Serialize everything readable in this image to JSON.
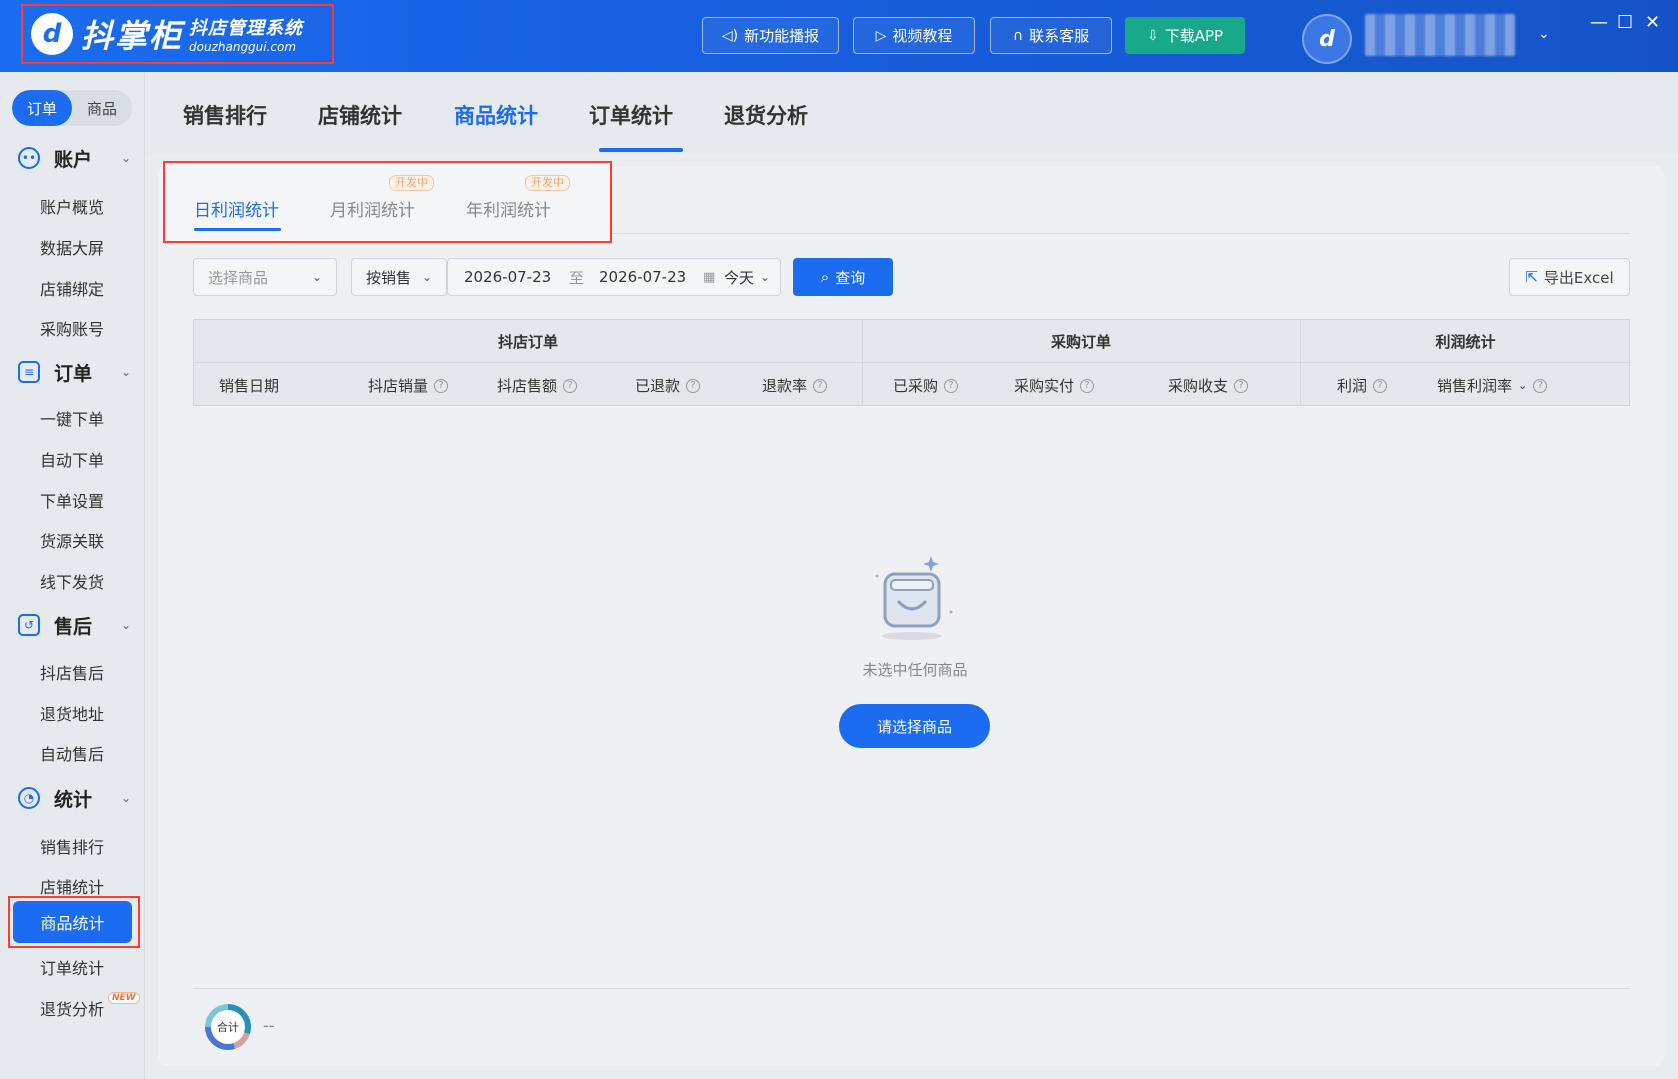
{
  "app": {
    "logo_name": "抖掌柜",
    "logo_subtitle": "抖店管理系统",
    "logo_domain": "douzhanggui.com"
  },
  "titlebar": {
    "buttons": [
      {
        "label": "新功能播报",
        "icon": "speaker-icon"
      },
      {
        "label": "视频教程",
        "icon": "video-icon"
      },
      {
        "label": "联系客服",
        "icon": "headset-icon"
      },
      {
        "label": "下载APP",
        "icon": "download-icon"
      }
    ],
    "window_controls": [
      "—",
      "☐",
      "✕"
    ]
  },
  "sidebar": {
    "segment": [
      "订单",
      "商品"
    ],
    "groups": [
      {
        "label": "账户",
        "items": [
          "账户概览",
          "数据大屏",
          "店铺绑定",
          "采购账号"
        ]
      },
      {
        "label": "订单",
        "items": [
          "一键下单",
          "自动下单",
          "下单设置",
          "货源关联",
          "线下发货"
        ]
      },
      {
        "label": "售后",
        "items": [
          "抖店售后",
          "退货地址",
          "自动售后"
        ]
      },
      {
        "label": "统计",
        "items": [
          "销售排行",
          "店铺统计",
          "商品统计",
          "订单统计",
          "退货分析"
        ]
      }
    ],
    "active_item": "商品统计",
    "new_badge": "NEW"
  },
  "top_tabs": [
    "销售排行",
    "店铺统计",
    "商品统计",
    "订单统计",
    "退货分析"
  ],
  "sub_tabs": [
    {
      "label": "日利润统计",
      "badge": ""
    },
    {
      "label": "月利润统计",
      "badge": "开发中"
    },
    {
      "label": "年利润统计",
      "badge": "开发中"
    }
  ],
  "filters": {
    "product_placeholder": "选择商品",
    "sort_by": "按销售",
    "date_from": "2026-07-23",
    "date_sep": "至",
    "date_to": "2026-07-23",
    "range": "今天",
    "query_label": "查询",
    "export_label": "导出Excel"
  },
  "table": {
    "groups": [
      "抖店订单",
      "采购订单",
      "利润统计"
    ],
    "columns": [
      "销售日期",
      "抖店销量",
      "抖店售额",
      "已退款",
      "退款率",
      "已采购",
      "采购实付",
      "采购收支",
      "利润",
      "销售利润率"
    ]
  },
  "empty": {
    "message": "未选中任何商品",
    "button": "请选择商品"
  },
  "footer": {
    "total_label": "合计",
    "total_value": "--"
  }
}
